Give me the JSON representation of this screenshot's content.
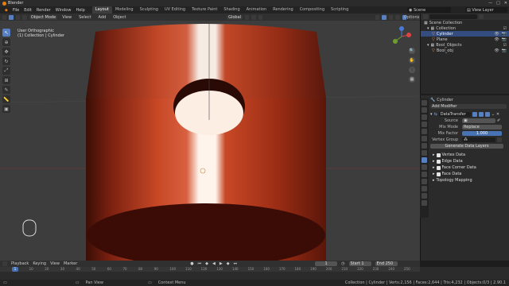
{
  "app": {
    "title": "Blender"
  },
  "window_controls": [
    "—",
    "□",
    "✕"
  ],
  "menu": [
    "File",
    "Edit",
    "Render",
    "Window",
    "Help"
  ],
  "workspaces": [
    {
      "label": "Layout",
      "active": true
    },
    {
      "label": "Modeling",
      "active": false
    },
    {
      "label": "Sculpting",
      "active": false
    },
    {
      "label": "UV Editing",
      "active": false
    },
    {
      "label": "Texture Paint",
      "active": false
    },
    {
      "label": "Shading",
      "active": false
    },
    {
      "label": "Animation",
      "active": false
    },
    {
      "label": "Rendering",
      "active": false
    },
    {
      "label": "Compositing",
      "active": false
    },
    {
      "label": "Scripting",
      "active": false
    }
  ],
  "scene": {
    "label": "Scene",
    "view_layer": "View Layer"
  },
  "viewport_header": {
    "mode": "Object Mode",
    "menus": [
      "View",
      "Select",
      "Add",
      "Object"
    ],
    "orientation": "Global",
    "options": "Options"
  },
  "viewport": {
    "view_name": "User Orthographic",
    "collection": "(1) Collection | Cylinder"
  },
  "outliner": {
    "rows": [
      {
        "label": "Scene Collection",
        "selected": false,
        "indent": 0
      },
      {
        "label": "Collection",
        "selected": false,
        "indent": 1
      },
      {
        "label": "Cylinder",
        "selected": true,
        "indent": 2
      },
      {
        "label": "Plane",
        "selected": false,
        "indent": 2
      },
      {
        "label": "Bool_Objects",
        "selected": false,
        "indent": 1
      },
      {
        "label": "Bool_obj",
        "selected": false,
        "indent": 2
      }
    ]
  },
  "properties": {
    "object_name": "Cylinder",
    "add_modifier": "Add Modifier",
    "modifier_name": "DataTransfer",
    "source_label": "Source",
    "mix_mode_label": "Mix Mode",
    "mix_mode_value": "Replace",
    "mix_factor_label": "Mix Factor",
    "mix_factor_value": "1.000",
    "vertex_group_label": "Vertex Group",
    "generate_button": "Generate Data Layers",
    "sections": [
      {
        "label": "Vertex Data",
        "checked": true
      },
      {
        "label": "Edge Data",
        "checked": true
      },
      {
        "label": "Face Corner Data",
        "checked": true
      },
      {
        "label": "Face Data",
        "checked": true
      },
      {
        "label": "Topology Mapping",
        "checked": false
      }
    ]
  },
  "timeline": {
    "menus": [
      "Playback",
      "Keying",
      "View",
      "Marker"
    ],
    "current_frame": "1",
    "start_label": "Start",
    "start_value": "1",
    "end_label": "End",
    "end_value": "250",
    "ticks": [
      "0",
      "10",
      "20",
      "30",
      "40",
      "50",
      "60",
      "70",
      "80",
      "90",
      "100",
      "110",
      "120",
      "130",
      "140",
      "150",
      "160",
      "170",
      "180",
      "190",
      "200",
      "210",
      "220",
      "230",
      "240",
      "250"
    ]
  },
  "statusbar": {
    "pan_view": "Pan View",
    "context_menu": "Context Menu",
    "stats": "Collection | Cylinder | Verts:2,156 | Faces:2,644 | Tris:4,232 | Objects:0/3 | 2.90.1"
  },
  "colors": {
    "accent": "#4772b3",
    "object": "#c8401e"
  }
}
